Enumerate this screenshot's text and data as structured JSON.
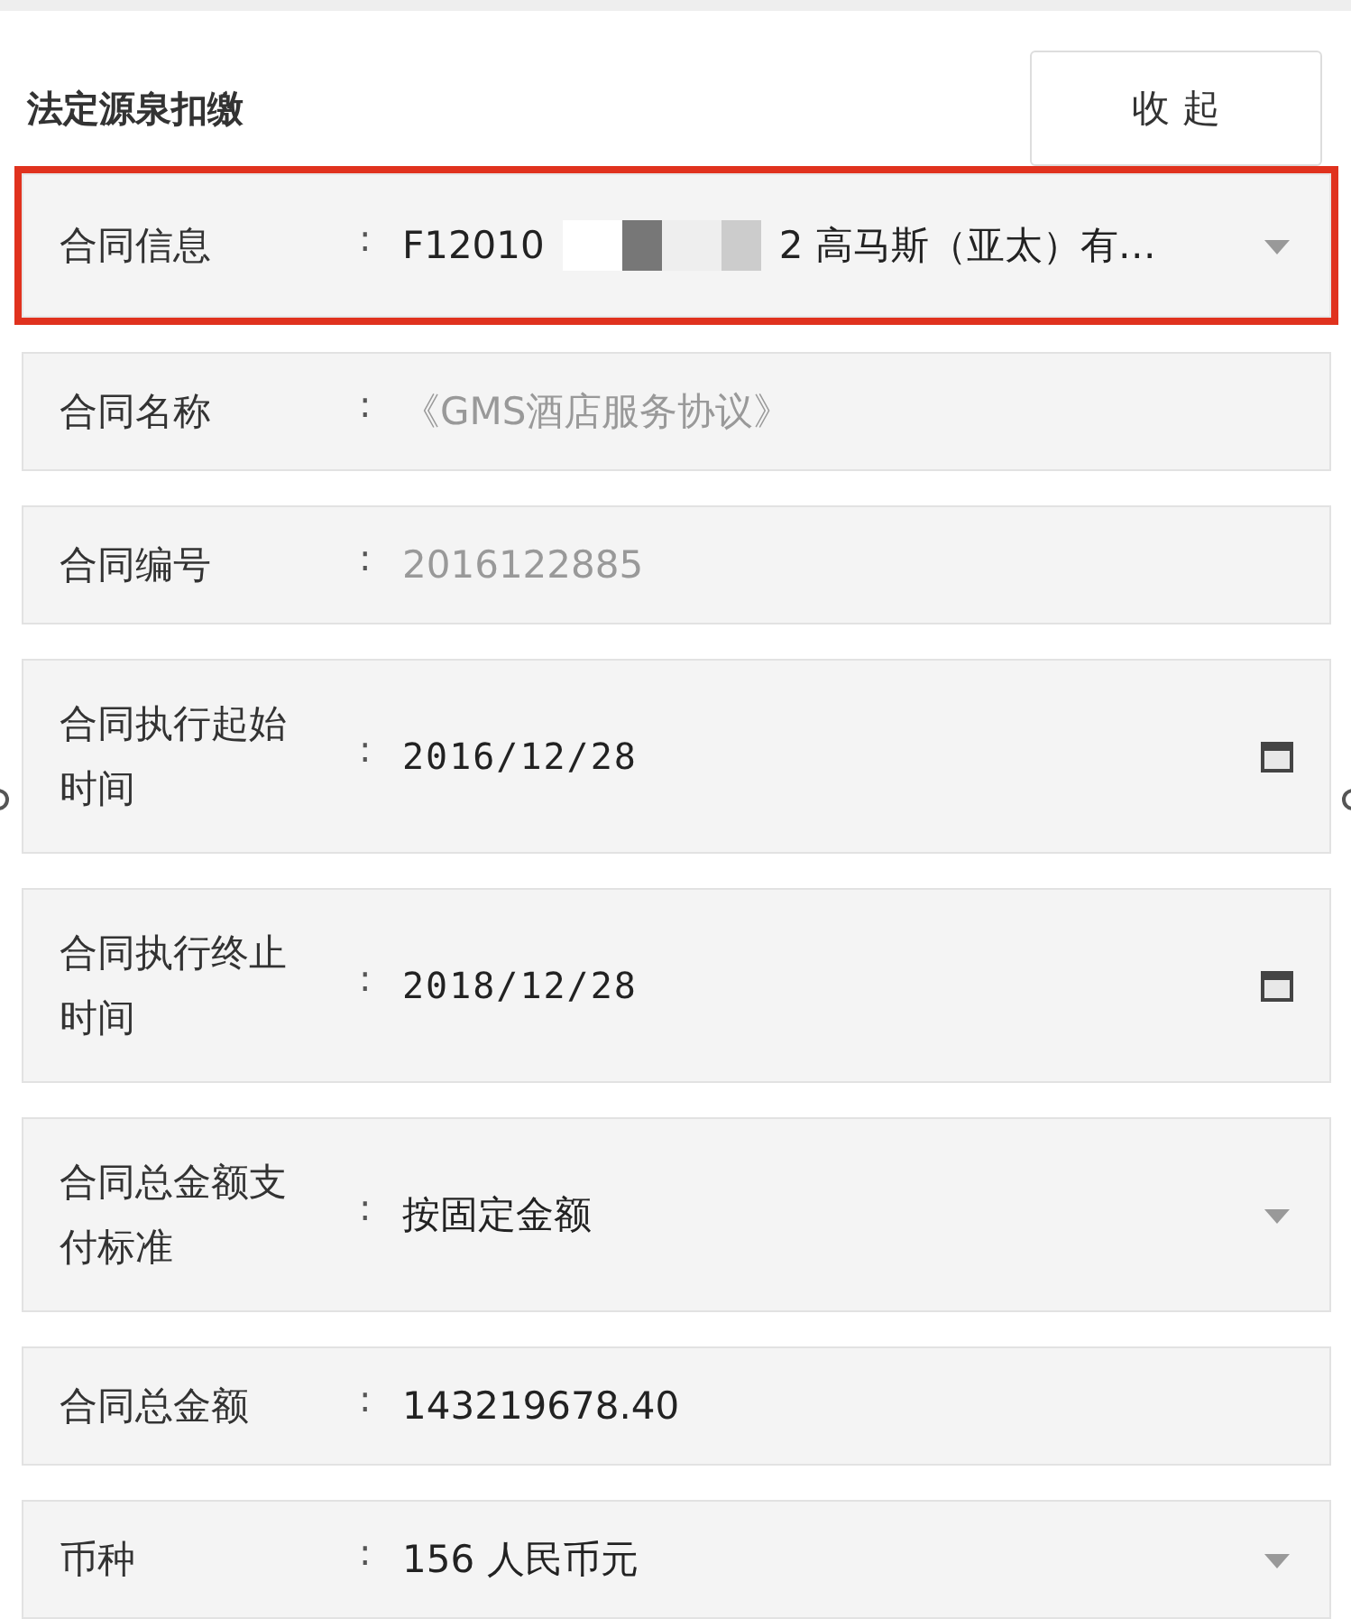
{
  "section": {
    "title": "法定源泉扣缴",
    "collapse_button": "收 起"
  },
  "fields": [
    {
      "kind": "select",
      "label": "合同信息",
      "separator": ":",
      "value": "F12010",
      "value_tail": "2 高马斯（亚太）有…",
      "redacted": true,
      "highlighted": true,
      "disabled": false
    },
    {
      "kind": "text",
      "label": "合同名称",
      "separator": ":",
      "value": "《GMS酒店服务协议》",
      "highlighted": false,
      "disabled": true
    },
    {
      "kind": "text",
      "label": "合同编号",
      "separator": ":",
      "value": "2016122885",
      "highlighted": false,
      "disabled": true
    },
    {
      "kind": "date",
      "label": "合同执行起始时间",
      "separator": ":",
      "value": "2016/12/28",
      "highlighted": false,
      "disabled": false
    },
    {
      "kind": "date",
      "label": "合同执行终止时间",
      "separator": ":",
      "value": "2018/12/28",
      "highlighted": false,
      "disabled": false
    },
    {
      "kind": "select",
      "label": "合同总金额支付标准",
      "separator": ":",
      "value": "按固定金额",
      "highlighted": false,
      "disabled": false
    },
    {
      "kind": "input",
      "label": "合同总金额",
      "separator": ":",
      "value": "143219678.40",
      "highlighted": false,
      "disabled": false
    },
    {
      "kind": "select",
      "label": "币种",
      "separator": ":",
      "value": "156 人民币元",
      "highlighted": false,
      "disabled": false
    }
  ]
}
